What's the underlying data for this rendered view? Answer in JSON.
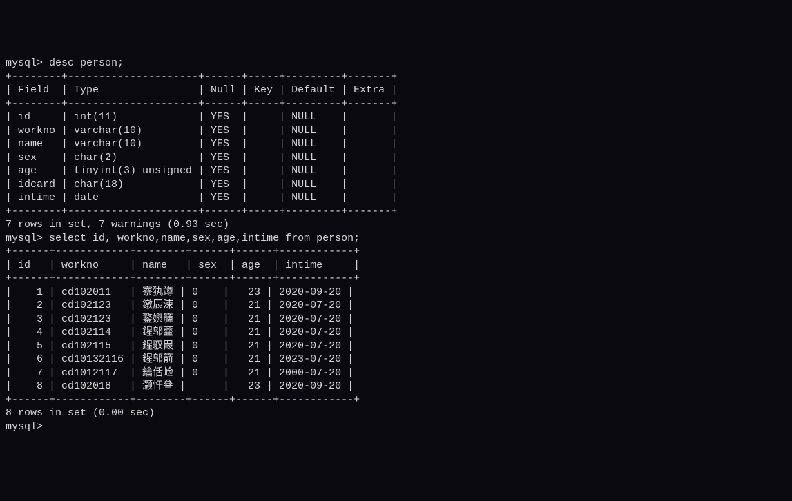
{
  "prompt": "mysql>",
  "command1": " desc person;",
  "desc_border_top": "+--------+---------------------+------+-----+---------+-------+",
  "desc_header": "| Field  | Type                | Null | Key | Default | Extra |",
  "desc_border_mid": "+--------+---------------------+------+-----+---------+-------+",
  "desc_rows": [
    "| id     | int(11)             | YES  |     | NULL    |       |",
    "| workno | varchar(10)         | YES  |     | NULL    |       |",
    "| name   | varchar(10)         | YES  |     | NULL    |       |",
    "| sex    | char(2)             | YES  |     | NULL    |       |",
    "| age    | tinyint(3) unsigned | YES  |     | NULL    |       |",
    "| idcard | char(18)            | YES  |     | NULL    |       |",
    "| intime | date                | YES  |     | NULL    |       |"
  ],
  "desc_border_bot": "+--------+---------------------+------+-----+---------+-------+",
  "status1": "7 rows in set, 7 warnings (0.93 sec)",
  "command2": " select id, workno,name,sex,age,intime from person;",
  "sel_border_top": "+------+------------+--------+------+------+------------+",
  "sel_header": "| id   | workno     | name   | sex  | age  | intime     |",
  "sel_border_mid": "+------+------------+--------+------+------+------------+",
  "sel_rows": [
    "|    1 | cd102011   | 寮犱竴 | 0    |   23 | 2020-09-20 |",
    "|    2 | cd102123   | 鐓辰涑 | 0    |   21 | 2020-07-20 |",
    "|    3 | cd102123   | 鐜嬩簲 | 0    |   21 | 2020-07-20 |",
    "|    4 | cd102114   | 鍟邬虀 | 0    |   21 | 2020-07-20 |",
    "|    5 | cd102115   | 鍟驭叚 | 0    |   21 | 2020-07-20 |",
    "|    6 | cd10132116 | 鍟邬箭 | 0    |   21 | 2023-07-20 |",
    "|    7 | cd1012117  | 鑰佸崄 | 0    |   21 | 2000-07-20 |",
    "|    8 | cd102018   | 灏忓叄 |      |   23 | 2020-09-20 |"
  ],
  "sel_border_bot": "+------+------------+--------+------+------+------------+",
  "status2": "8 rows in set (0.00 sec)",
  "chart_data": {
    "type": "table",
    "tables": [
      {
        "title": "desc person",
        "columns": [
          "Field",
          "Type",
          "Null",
          "Key",
          "Default",
          "Extra"
        ],
        "rows": [
          [
            "id",
            "int(11)",
            "YES",
            "",
            "NULL",
            ""
          ],
          [
            "workno",
            "varchar(10)",
            "YES",
            "",
            "NULL",
            ""
          ],
          [
            "name",
            "varchar(10)",
            "YES",
            "",
            "NULL",
            ""
          ],
          [
            "sex",
            "char(2)",
            "YES",
            "",
            "NULL",
            ""
          ],
          [
            "age",
            "tinyint(3) unsigned",
            "YES",
            "",
            "NULL",
            ""
          ],
          [
            "idcard",
            "char(18)",
            "YES",
            "",
            "NULL",
            ""
          ],
          [
            "intime",
            "date",
            "YES",
            "",
            "NULL",
            ""
          ]
        ]
      },
      {
        "title": "select id, workno,name,sex,age,intime from person",
        "columns": [
          "id",
          "workno",
          "name",
          "sex",
          "age",
          "intime"
        ],
        "rows": [
          [
            1,
            "cd102011",
            "寮犱竴",
            "0",
            23,
            "2020-09-20"
          ],
          [
            2,
            "cd102123",
            "鐓辰涑",
            "0",
            21,
            "2020-07-20"
          ],
          [
            3,
            "cd102123",
            "鐜嬩簲",
            "0",
            21,
            "2020-07-20"
          ],
          [
            4,
            "cd102114",
            "鍟邬虀",
            "0",
            21,
            "2020-07-20"
          ],
          [
            5,
            "cd102115",
            "鍟驭叚",
            "0",
            21,
            "2020-07-20"
          ],
          [
            6,
            "cd10132116",
            "鍟邬箭",
            "0",
            21,
            "2023-07-20"
          ],
          [
            7,
            "cd1012117",
            "鑰佸崄",
            "0",
            21,
            "2000-07-20"
          ],
          [
            8,
            "cd102018",
            "灏忓叄",
            "",
            23,
            "2020-09-20"
          ]
        ]
      }
    ]
  }
}
